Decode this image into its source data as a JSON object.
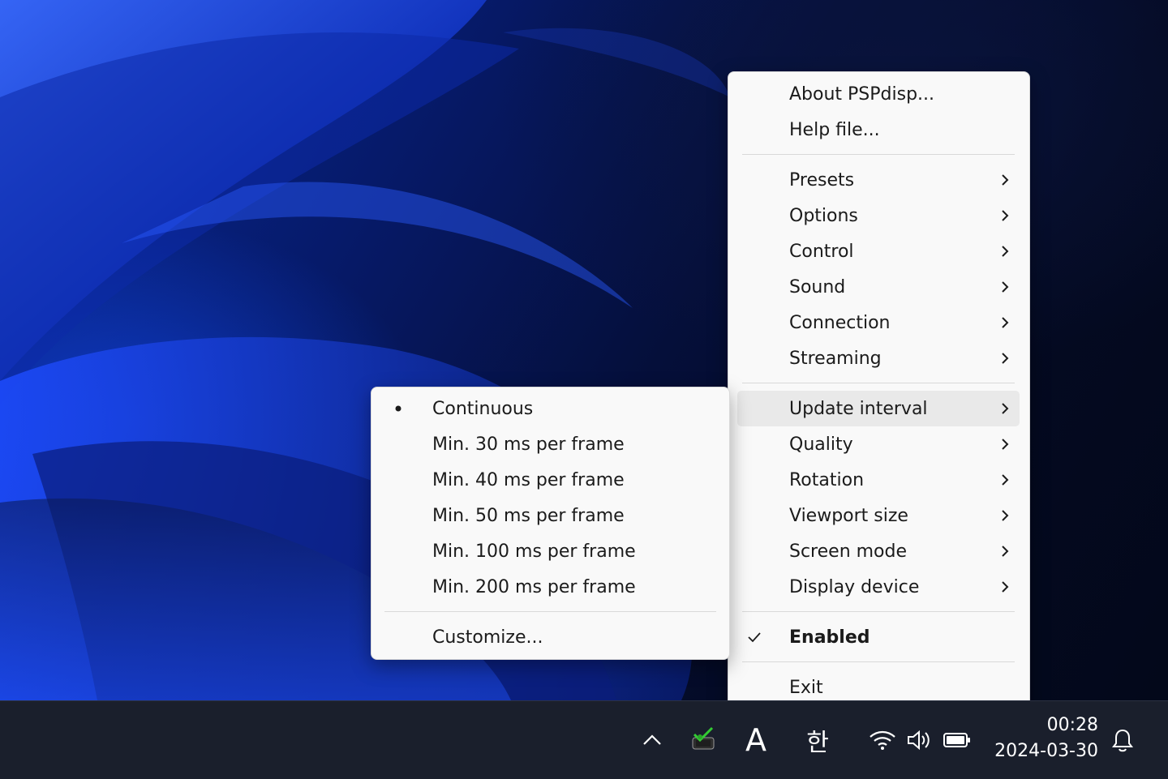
{
  "main_menu": {
    "group1": [
      {
        "label": "About PSPdisp..."
      },
      {
        "label": "Help file..."
      }
    ],
    "group2": [
      {
        "label": "Presets"
      },
      {
        "label": "Options"
      },
      {
        "label": "Control"
      },
      {
        "label": "Sound"
      },
      {
        "label": "Connection"
      },
      {
        "label": "Streaming"
      }
    ],
    "group3": [
      {
        "label": "Update interval"
      },
      {
        "label": "Quality"
      },
      {
        "label": "Rotation"
      },
      {
        "label": "Viewport size"
      },
      {
        "label": "Screen mode"
      },
      {
        "label": "Display device"
      }
    ],
    "enabled": {
      "label": "Enabled",
      "checked": true
    },
    "exit": {
      "label": "Exit"
    }
  },
  "submenu": {
    "items": [
      {
        "label": "Continuous",
        "selected": true
      },
      {
        "label": "Min. 30 ms per frame"
      },
      {
        "label": "Min. 40 ms per frame"
      },
      {
        "label": "Min. 50 ms per frame"
      },
      {
        "label": "Min. 100 ms per frame"
      },
      {
        "label": "Min. 200 ms per frame"
      }
    ],
    "customize": {
      "label": "Customize..."
    }
  },
  "taskbar": {
    "ime_label": "A",
    "korean_label": "한",
    "time": "00:28",
    "date": "2024-03-30",
    "icons": [
      "chevron-up-icon",
      "pspdisp-tray-icon",
      "wifi-icon",
      "volume-icon",
      "battery-icon",
      "bell-icon"
    ]
  },
  "colors": {
    "menu_bg": "#f9f9f9",
    "highlight": "#e9e9e9",
    "taskbar_bg": "#1a1f2c"
  }
}
